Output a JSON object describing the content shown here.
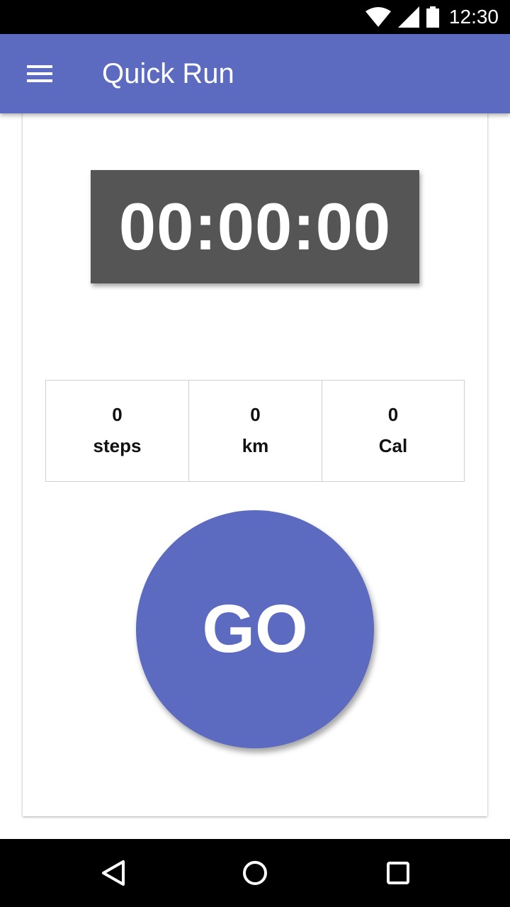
{
  "status_bar": {
    "time": "12:30",
    "icons": [
      "wifi-icon",
      "signal-icon",
      "battery-icon"
    ]
  },
  "app_bar": {
    "title": "Quick Run",
    "menu_icon": "menu-icon"
  },
  "timer": {
    "display": "00:00:00"
  },
  "stats": [
    {
      "value": "0",
      "unit": "steps"
    },
    {
      "value": "0",
      "unit": "km"
    },
    {
      "value": "0",
      "unit": "Cal"
    }
  ],
  "go_button": {
    "label": "GO"
  },
  "nav_bar": {
    "icons": [
      "back-icon",
      "home-icon",
      "recents-icon"
    ]
  },
  "colors": {
    "primary": "#5c6bc0",
    "timer_bg": "#555555",
    "status_bar": "#000000"
  }
}
